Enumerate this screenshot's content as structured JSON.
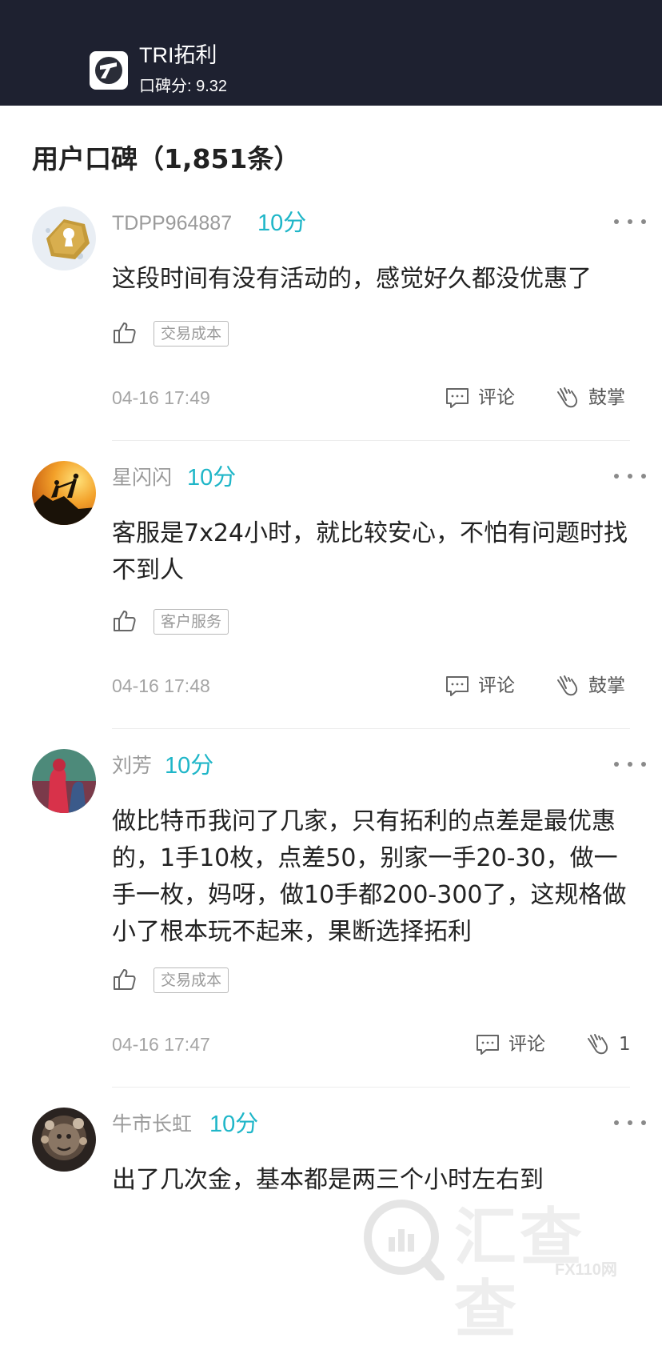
{
  "header": {
    "broker_name": "TRI拓利",
    "score_label": "口碑分: 9.32"
  },
  "section_title": "用户口碑（1,851条）",
  "reviews": [
    {
      "username": "TDPP964887",
      "score": "10分",
      "content": "这段时间有没有活动的，感觉好久都没优惠了",
      "tag": "交易成本",
      "time": "04-16 17:49",
      "comment_label": "评论",
      "clap_label": "鼓掌"
    },
    {
      "username": "星闪闪",
      "score": "10分",
      "content": "客服是7x24小时，就比较安心，不怕有问题时找不到人",
      "tag": "客户服务",
      "time": "04-16 17:48",
      "comment_label": "评论",
      "clap_label": "鼓掌"
    },
    {
      "username": "刘芳",
      "score": "10分",
      "content": "做比特币我问了几家，只有拓利的点差是最优惠的，1手10枚，点差50，别家一手20-30，做一手一枚，妈呀，做10手都200-300了，这规格做小了根本玩不起来，果断选择拓利",
      "tag": "交易成本",
      "time": "04-16 17:47",
      "comment_label": "评论",
      "clap_label": "1"
    },
    {
      "username": "牛市长虹",
      "score": "10分",
      "content": "出了几次金，基本都是两三个小时左右到"
    }
  ],
  "icons": {
    "logo": "broker-logo-icon",
    "more": "more-dots-icon",
    "like": "thumbs-up-icon",
    "comment": "comment-icon",
    "clap": "clap-icon"
  },
  "colors": {
    "header_bg": "#1e2130",
    "score_accent": "#1fb6c8",
    "username": "#9b9b9b"
  },
  "watermark": {
    "brand": "汇查查",
    "domain": "FX110网"
  }
}
